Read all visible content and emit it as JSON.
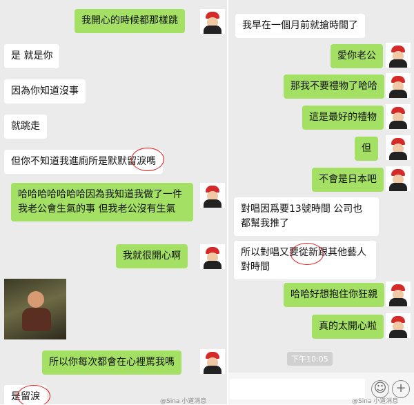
{
  "left_chat": {
    "messages": [
      {
        "text": "我開心的時候都那樣跳"
      },
      {
        "text": "是 就是你"
      },
      {
        "text": "因為你知道沒事"
      },
      {
        "text": "就跳走"
      },
      {
        "text": "但你不知道我進廁所是默默留淚嗎"
      },
      {
        "text": "哈哈哈哈哈哈哈因為我知道我做了一件我老公會生氣的事 但我老公沒有生氣"
      },
      {
        "text": "我就很開心啊"
      },
      {
        "text": "所以你每次都會在心裡罵我嗎"
      },
      {
        "text": "是留淚"
      }
    ]
  },
  "right_chat": {
    "messages": [
      {
        "text": "我早在一個月前就搶時間了"
      },
      {
        "text": "愛你老公"
      },
      {
        "text": "那我不要禮物了哈哈"
      },
      {
        "text": "這是最好的禮物"
      },
      {
        "text": "但"
      },
      {
        "text": "不會是日本吧"
      },
      {
        "text": "對唱因爲要13號時間 公司也都幫我推了"
      },
      {
        "text": "所以對唱又要從新跟其他藝人對時間"
      },
      {
        "text": "哈哈好想抱住你狂親"
      },
      {
        "text": "真的太開心啦"
      }
    ],
    "timestamp": "下午10:05"
  },
  "input": {
    "emoji_icon": "smile-face",
    "plus_icon": "plus",
    "plus_glyph": "+",
    "emoji_glyph": "☺"
  },
  "watermarks": [
    "@Sina 小道消息",
    "@Sina 小道消息"
  ],
  "colors": {
    "green_bubble": "#a3e063",
    "white_bubble": "#ffffff",
    "background": "#ebebeb",
    "annotation": "#e02020"
  }
}
